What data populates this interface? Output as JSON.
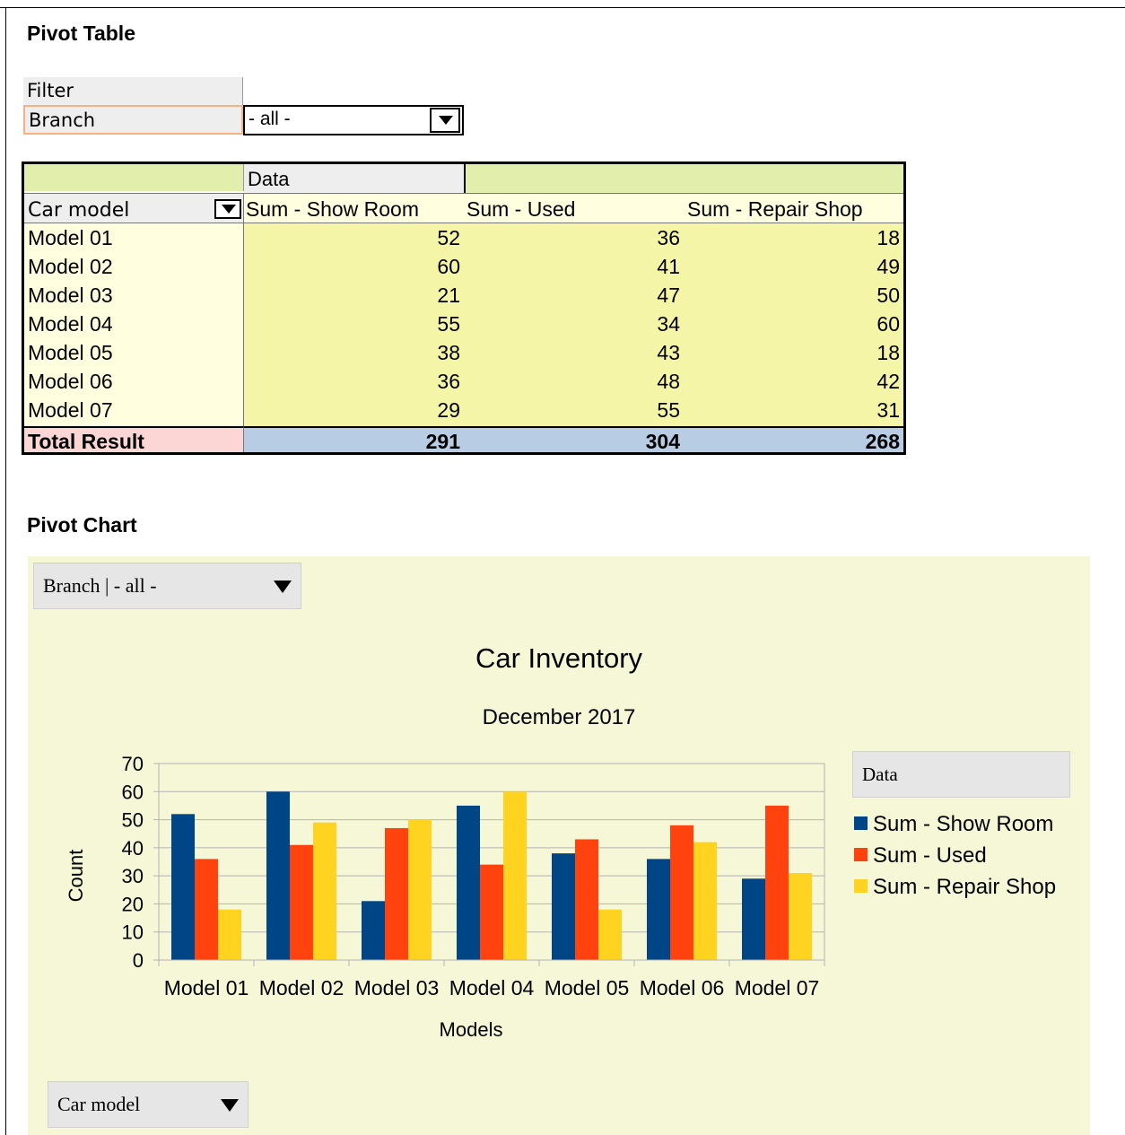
{
  "pivot_table": {
    "section_title": "Pivot Table",
    "filter_label": "Filter",
    "filter_field": "Branch",
    "filter_value": "- all -",
    "data_header": "Data",
    "row_field": "Car model",
    "column_headers": [
      "Sum - Show Room",
      "Sum - Used",
      "Sum - Repair Shop"
    ],
    "rows": [
      {
        "label": "Model 01",
        "values": [
          "52",
          "36",
          "18"
        ]
      },
      {
        "label": "Model 02",
        "values": [
          "60",
          "41",
          "49"
        ]
      },
      {
        "label": "Model 03",
        "values": [
          "21",
          "47",
          "50"
        ]
      },
      {
        "label": "Model 04",
        "values": [
          "55",
          "34",
          "60"
        ]
      },
      {
        "label": "Model 05",
        "values": [
          "38",
          "43",
          "18"
        ]
      },
      {
        "label": "Model 06",
        "values": [
          "36",
          "48",
          "42"
        ]
      },
      {
        "label": "Model 07",
        "values": [
          "29",
          "55",
          "31"
        ]
      }
    ],
    "total_label": "Total Result",
    "totals": [
      "291",
      "304",
      "268"
    ],
    "colors": {
      "header_green": "#e2eeab",
      "row_area": "#ffffe0",
      "values_area": "#f5f5a8",
      "total_label": "#fcd5d5",
      "total_values": "#b8cce4"
    }
  },
  "pivot_chart": {
    "section_title": "Pivot Chart",
    "branch_filter": "Branch | - all -",
    "row_field_button": "Car model",
    "legend_title": "Data",
    "background": "#f6f7d6"
  },
  "chart_data": {
    "type": "bar",
    "title": "Car Inventory",
    "subtitle": "December 2017",
    "xlabel": "Models",
    "ylabel": "Count",
    "ylim": [
      0,
      70
    ],
    "yticks": [
      0,
      10,
      20,
      30,
      40,
      50,
      60,
      70
    ],
    "grid": true,
    "legend_position": "right",
    "categories": [
      "Model 01",
      "Model 02",
      "Model 03",
      "Model 04",
      "Model 05",
      "Model 06",
      "Model 07"
    ],
    "series": [
      {
        "name": "Sum - Show Room",
        "color": "#004586",
        "values": [
          52,
          60,
          21,
          55,
          38,
          36,
          29
        ]
      },
      {
        "name": "Sum - Used",
        "color": "#ff420e",
        "values": [
          36,
          41,
          47,
          34,
          43,
          48,
          55
        ]
      },
      {
        "name": "Sum - Repair Shop",
        "color": "#ffd320",
        "values": [
          18,
          49,
          50,
          60,
          18,
          42,
          31
        ]
      }
    ]
  }
}
